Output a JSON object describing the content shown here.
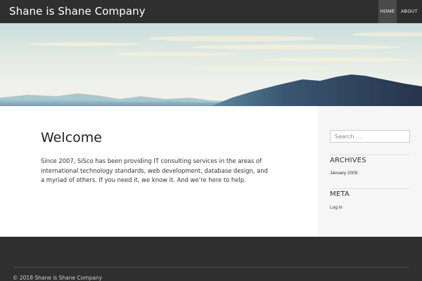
{
  "header": {
    "site_title": "Shane is Shane Company",
    "nav": [
      {
        "label": "HOME",
        "active": true
      },
      {
        "label": "ABOUT",
        "active": false
      }
    ]
  },
  "page": {
    "title": "Welcome",
    "body": "Since 2007, SiSco has been providing IT consulting services in the areas of international technology standards, web development, database design, and a myriad of others.  If you need it, we know it.  And we’re here to help."
  },
  "sidebar": {
    "search_placeholder": "Search …",
    "archives_title": "ARCHIVES",
    "archives": [
      "January 2009"
    ],
    "meta_title": "META",
    "meta_links": [
      "Log in"
    ]
  },
  "footer": {
    "copyright": "© 2018 Shane is Shane Company"
  },
  "colors": {
    "header_bg": "#2f2f2f",
    "footer_bg": "#2f2f2f",
    "nav_active_bg": "#4a4a4a",
    "sidebar_bg": "#f6f6f6",
    "mountain_dark": "#2d3f58",
    "mountain_far": "#8fb3c2"
  },
  "icons": {
    "hero": "mountain-landscape-image"
  }
}
